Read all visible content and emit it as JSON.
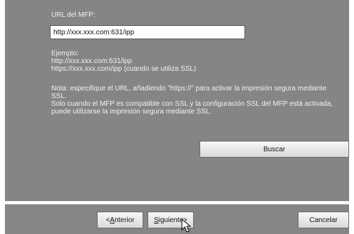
{
  "url_label": "URL del MFP:",
  "url_input_value": "http://xxx.xxx.com:631/ipp",
  "example_text": "Ejemplo:\nhttp://xxx.xxx.com:631/ipp\nhttps://xxx.xxx.com/ipp (cuando se utiliza SSL)",
  "note_text": "Nota: especifique el URL, añadiendo \"https://\" para activar la impresión segura mediante\nSSL.\nSolo cuando el MFP es compatible con SSL y la configuración SSL del MFP está activada,\npuede utilizarse la impresión segura mediante SSL.",
  "buttons": {
    "buscar": "Buscar",
    "anterior_prefix": "< ",
    "anterior_mnemonic": "A",
    "anterior_rest": "nterior",
    "siguiente_mnemonic": "S",
    "siguiente_rest": "iguiente",
    "siguiente_suffix": " >",
    "cancelar": "Cancelar"
  },
  "icons": {
    "cursor": "mouse-cursor-icon"
  }
}
